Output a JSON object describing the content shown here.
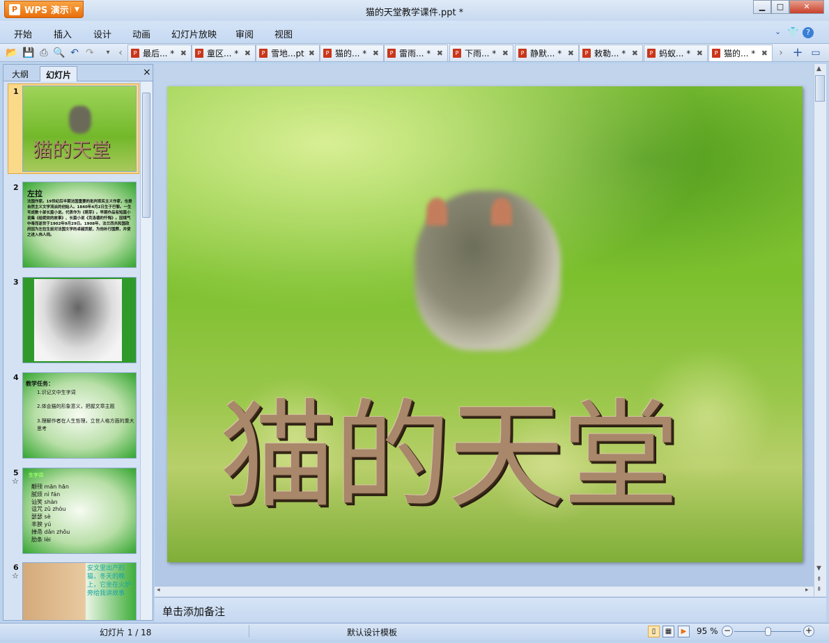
{
  "app": {
    "name": "WPS 演示",
    "window_title": "猫的天堂教学课件.ppt *"
  },
  "menu": [
    "开始",
    "插入",
    "设计",
    "动画",
    "幻灯片放映",
    "审阅",
    "视图"
  ],
  "doc_tabs": [
    {
      "label": "最后... *"
    },
    {
      "label": "童区... *"
    },
    {
      "label": "雪地...pt"
    },
    {
      "label": "猫的... *"
    },
    {
      "label": "雷雨... *"
    },
    {
      "label": "下雨... *"
    },
    {
      "label": "静默... *"
    },
    {
      "label": "敕勒... *"
    },
    {
      "label": "蚂蚁... *"
    },
    {
      "label": "猫的... *",
      "active": true
    }
  ],
  "panel": {
    "tabs": [
      "大纲",
      "幻灯片"
    ],
    "active_tab": "幻灯片",
    "close": "×"
  },
  "thumbnails": [
    {
      "num": "1",
      "title": "猫的天堂"
    },
    {
      "num": "2",
      "title": "左拉",
      "body": "法国作家。19世纪后半期法国重要的批判现实主义作家，也是自然主义文学流派的创始人。1840年4月2日生于巴黎。一生写成数十部长篇小说。代表作为《萌芽》。早期作品有短篇小说集《给妮侬的故事》、长篇小说《克洛德的忏悔》。因煤气中毒而逝世于1902年9月29日。1908年，法兰西共和国政府因为左拉生前对法国文学的卓越贡献，为他补行国葬，并使之进入伟人祠。"
    },
    {
      "num": "3"
    },
    {
      "num": "4",
      "title": "教学任务：",
      "items": [
        "1.识记文中生字词",
        "2.体会猫的形象意义，把握文章主题",
        "3.理解作者在人生哲理，立世人格方面的重大思考"
      ]
    },
    {
      "num": "5",
      "star": "☆",
      "title": "生字词",
      "words": [
        "颟顸 mān hān",
        "腻烦 nì fán",
        "讪笑 shàn",
        "诅咒 zǔ zhòu",
        "瑟瑟 sè",
        "丰腴 yú",
        "掸帚 dǎn zhǒu",
        "肋条 lèi"
      ]
    },
    {
      "num": "6",
      "star": "☆",
      "text": "安文里出产的猫，冬天的晚上，它坐在火炉旁给我讲故事"
    }
  ],
  "slide": {
    "title": "猫的天堂"
  },
  "notes_placeholder": "单击添加备注",
  "status": {
    "slide_indicator": "幻灯片 1 / 18",
    "template": "默认设计模板",
    "zoom": "95 %",
    "zoom_level_percent": 95
  },
  "colors": {
    "wps_orange": "#e86f0c",
    "chrome_blue": "#c5d9f2",
    "slide_green": "#7cc02e",
    "title_brown": "#a8876a"
  }
}
